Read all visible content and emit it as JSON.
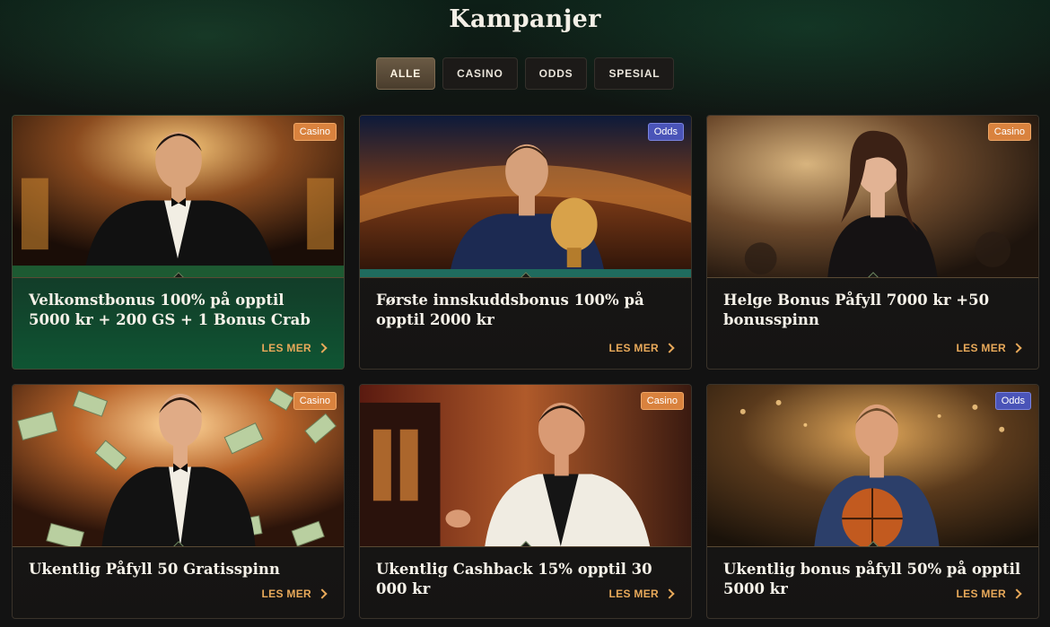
{
  "page": {
    "title": "Kampanjer"
  },
  "filters": [
    {
      "label": "ALLE",
      "active": true
    },
    {
      "label": "CASINO",
      "active": false
    },
    {
      "label": "ODDS",
      "active": false
    },
    {
      "label": "SPESIAL",
      "active": false
    }
  ],
  "cards": [
    {
      "title": "Velkomstbonus 100% på opptil 5000 kr + 200 GS + 1 Bonus Crab",
      "badge": "Casino",
      "cta": "LES MER",
      "image": "man-in-tuxedo-at-casino-table"
    },
    {
      "title": "Første innskuddsbonus 100% på opptil 2000 kr",
      "badge": "Odds",
      "cta": "LES MER",
      "image": "football-player-with-trophy"
    },
    {
      "title": "Helge Bonus Påfyll 7000 kr +50 bonusspinn",
      "badge": "Casino",
      "cta": "LES MER",
      "image": "woman-in-black-dress"
    },
    {
      "title": "Ukentlig Påfyll 50 Gratisspinn",
      "badge": "Casino",
      "cta": "LES MER",
      "image": "man-with-flying-money"
    },
    {
      "title": "Ukentlig Cashback 15% opptil 30 000 kr",
      "badge": "Casino",
      "cta": "LES MER",
      "image": "smiling-man-at-slot-machine"
    },
    {
      "title": "Ukentlig bonus påfyll 50% på opptil 5000 kr",
      "badge": "Odds",
      "cta": "LES MER",
      "image": "basketball-player"
    }
  ],
  "colors": {
    "accent": "#e8a95a",
    "casino_badge": "#d9823e",
    "odds_badge": "#4a54b8"
  }
}
